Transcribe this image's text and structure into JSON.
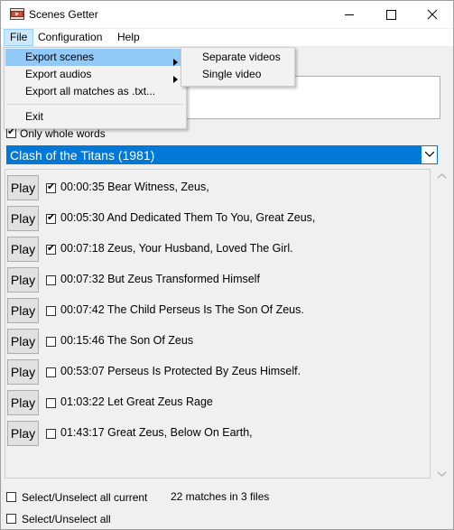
{
  "window": {
    "title": "Scenes Getter"
  },
  "menubar": {
    "items": [
      {
        "label": "File"
      },
      {
        "label": "Configuration"
      },
      {
        "label": "Help"
      }
    ]
  },
  "file_menu": {
    "items": [
      {
        "label": "Export scenes",
        "submenu": true
      },
      {
        "label": "Export audios",
        "submenu": true
      },
      {
        "label": "Export all matches as .txt..."
      },
      {
        "label": "Exit"
      }
    ]
  },
  "export_scenes_submenu": {
    "items": [
      {
        "label": "Separate videos"
      },
      {
        "label": "Single video"
      }
    ]
  },
  "options": {
    "only_whole_words": {
      "label": "Only whole words",
      "checked": true
    }
  },
  "movie_select": {
    "selected": "Clash of the Titans (1981)"
  },
  "matches": [
    {
      "play": "Play",
      "checked": true,
      "text": "00:00:35 Bear Witness, Zeus,"
    },
    {
      "play": "Play",
      "checked": true,
      "text": "00:05:30 And Dedicated Them To You, Great Zeus,"
    },
    {
      "play": "Play",
      "checked": true,
      "text": "00:07:18 Zeus, Your Husband, Loved The Girl."
    },
    {
      "play": "Play",
      "checked": false,
      "text": "00:07:32 But Zeus Transformed Himself"
    },
    {
      "play": "Play",
      "checked": false,
      "text": "00:07:42 The Child Perseus Is The Son Of Zeus."
    },
    {
      "play": "Play",
      "checked": false,
      "text": "00:15:46 The Son Of Zeus"
    },
    {
      "play": "Play",
      "checked": false,
      "text": "00:53:07 Perseus Is Protected By Zeus Himself."
    },
    {
      "play": "Play",
      "checked": false,
      "text": "01:03:22 Let Great Zeus Rage"
    },
    {
      "play": "Play",
      "checked": false,
      "text": "01:43:17 Great Zeus, Below On Earth,"
    }
  ],
  "footer": {
    "select_current": {
      "label": "Select/Unselect all current",
      "checked": false
    },
    "select_all": {
      "label": "Select/Unselect all",
      "checked": false
    },
    "status": "22 matches in 3 files"
  },
  "colors": {
    "accent": "#0078d7",
    "menu_highlight": "#91c9f7",
    "menubar_active": "#cce8ff"
  }
}
